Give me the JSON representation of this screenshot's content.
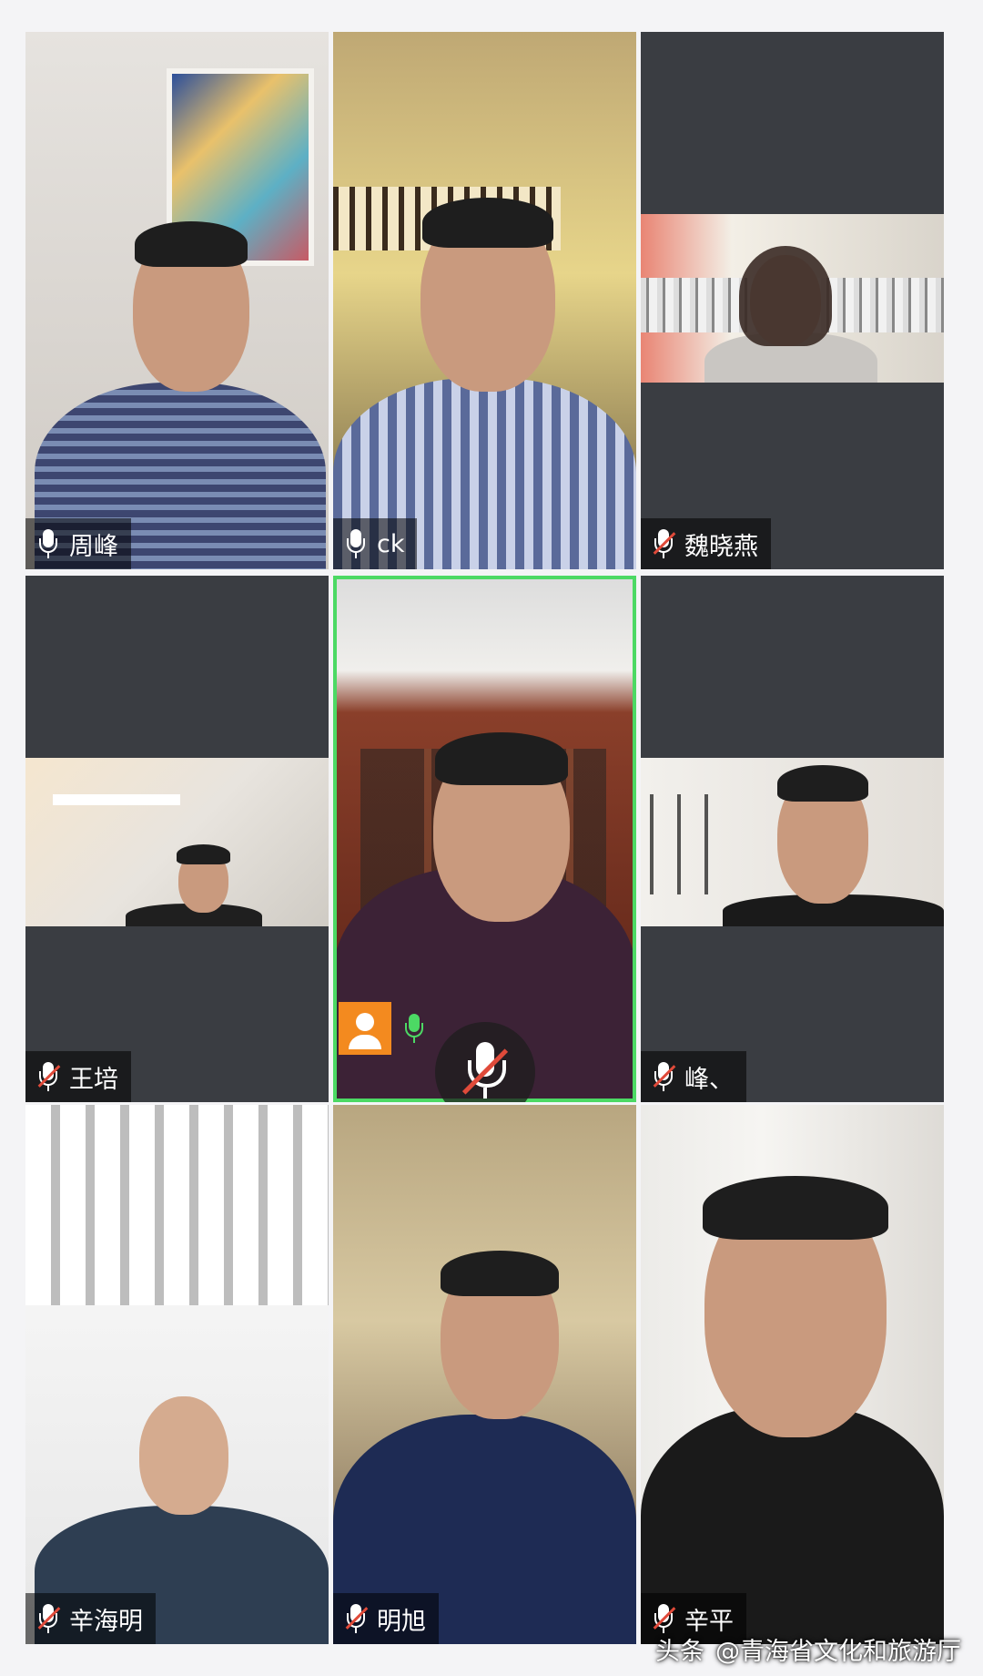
{
  "participants": [
    {
      "name": "周峰",
      "mic": "on"
    },
    {
      "name": "ck",
      "mic": "on"
    },
    {
      "name": "魏晓燕",
      "mic": "muted"
    },
    {
      "name": "王培",
      "mic": "muted"
    },
    {
      "name": "",
      "mic": "on",
      "active_speaker": true
    },
    {
      "name": "峰、",
      "mic": "muted"
    },
    {
      "name": "辛海明",
      "mic": "muted"
    },
    {
      "name": "明旭",
      "mic": "muted"
    },
    {
      "name": "辛平",
      "mic": "muted"
    }
  ],
  "colors": {
    "tile_bg": "#3a3d42",
    "active_border": "#4cd964",
    "muted_slash": "#e04a3a",
    "avatar_button": "#f38a1f"
  },
  "icons": {
    "mic_on": "microphone-icon",
    "mic_off": "microphone-muted-icon",
    "avatar": "person-avatar-icon"
  },
  "watermark": {
    "source": "头条",
    "account": "@青海省文化和旅游厅"
  }
}
